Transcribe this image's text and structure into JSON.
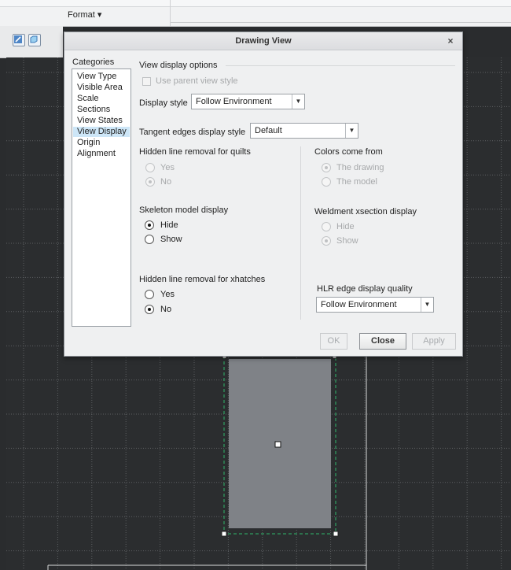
{
  "ribbon": {
    "format_menu": "Format ▾"
  },
  "toolbar": {
    "tools": [
      {
        "icon": "drawing-edit-icon"
      },
      {
        "icon": "view-box-icon"
      }
    ]
  },
  "dialog": {
    "title": "Drawing View",
    "close_glyph": "×",
    "categories_label": "Categories",
    "categories": [
      "View Type",
      "Visible Area",
      "Scale",
      "Sections",
      "View States",
      "View Display",
      "Origin",
      "Alignment"
    ],
    "selected_category": "View Display",
    "view_display_options_header": "View display options",
    "use_parent_view_style": {
      "label": "Use parent view style",
      "checked": false,
      "enabled": false
    },
    "display_style": {
      "label": "Display style",
      "value": "Follow Environment"
    },
    "tangent_edges": {
      "label": "Tangent edges display style",
      "value": "Default"
    },
    "hidden_line_quilts": {
      "label": "Hidden line removal for quilts",
      "options": [
        {
          "label": "Yes",
          "selected": false
        },
        {
          "label": "No",
          "selected": true
        }
      ],
      "enabled": false
    },
    "colors_come_from": {
      "label": "Colors come from",
      "options": [
        {
          "label": "The drawing",
          "selected": true
        },
        {
          "label": "The model",
          "selected": false
        }
      ],
      "enabled": false
    },
    "skeleton_display": {
      "label": "Skeleton model display",
      "options": [
        {
          "label": "Hide",
          "selected": true
        },
        {
          "label": "Show",
          "selected": false
        }
      ],
      "enabled": true
    },
    "weldment_display": {
      "label": "Weldment xsection display",
      "options": [
        {
          "label": "Hide",
          "selected": false
        },
        {
          "label": "Show",
          "selected": true
        }
      ],
      "enabled": false
    },
    "hidden_line_xhatches": {
      "label": "Hidden line removal for xhatches",
      "options": [
        {
          "label": "Yes",
          "selected": false
        },
        {
          "label": "No",
          "selected": true
        }
      ],
      "enabled": true
    },
    "hlr_quality": {
      "label": "HLR edge display quality",
      "value": "Follow Environment"
    },
    "buttons": {
      "ok": "OK",
      "close": "Close",
      "apply": "Apply"
    }
  },
  "colors": {
    "canvas_bg": "#2b2d2f",
    "grid_line": "#5c5f62",
    "view_fill": "#7f8287",
    "view_frame": "#2fb86b",
    "selection_accent": "#cde6f7"
  }
}
